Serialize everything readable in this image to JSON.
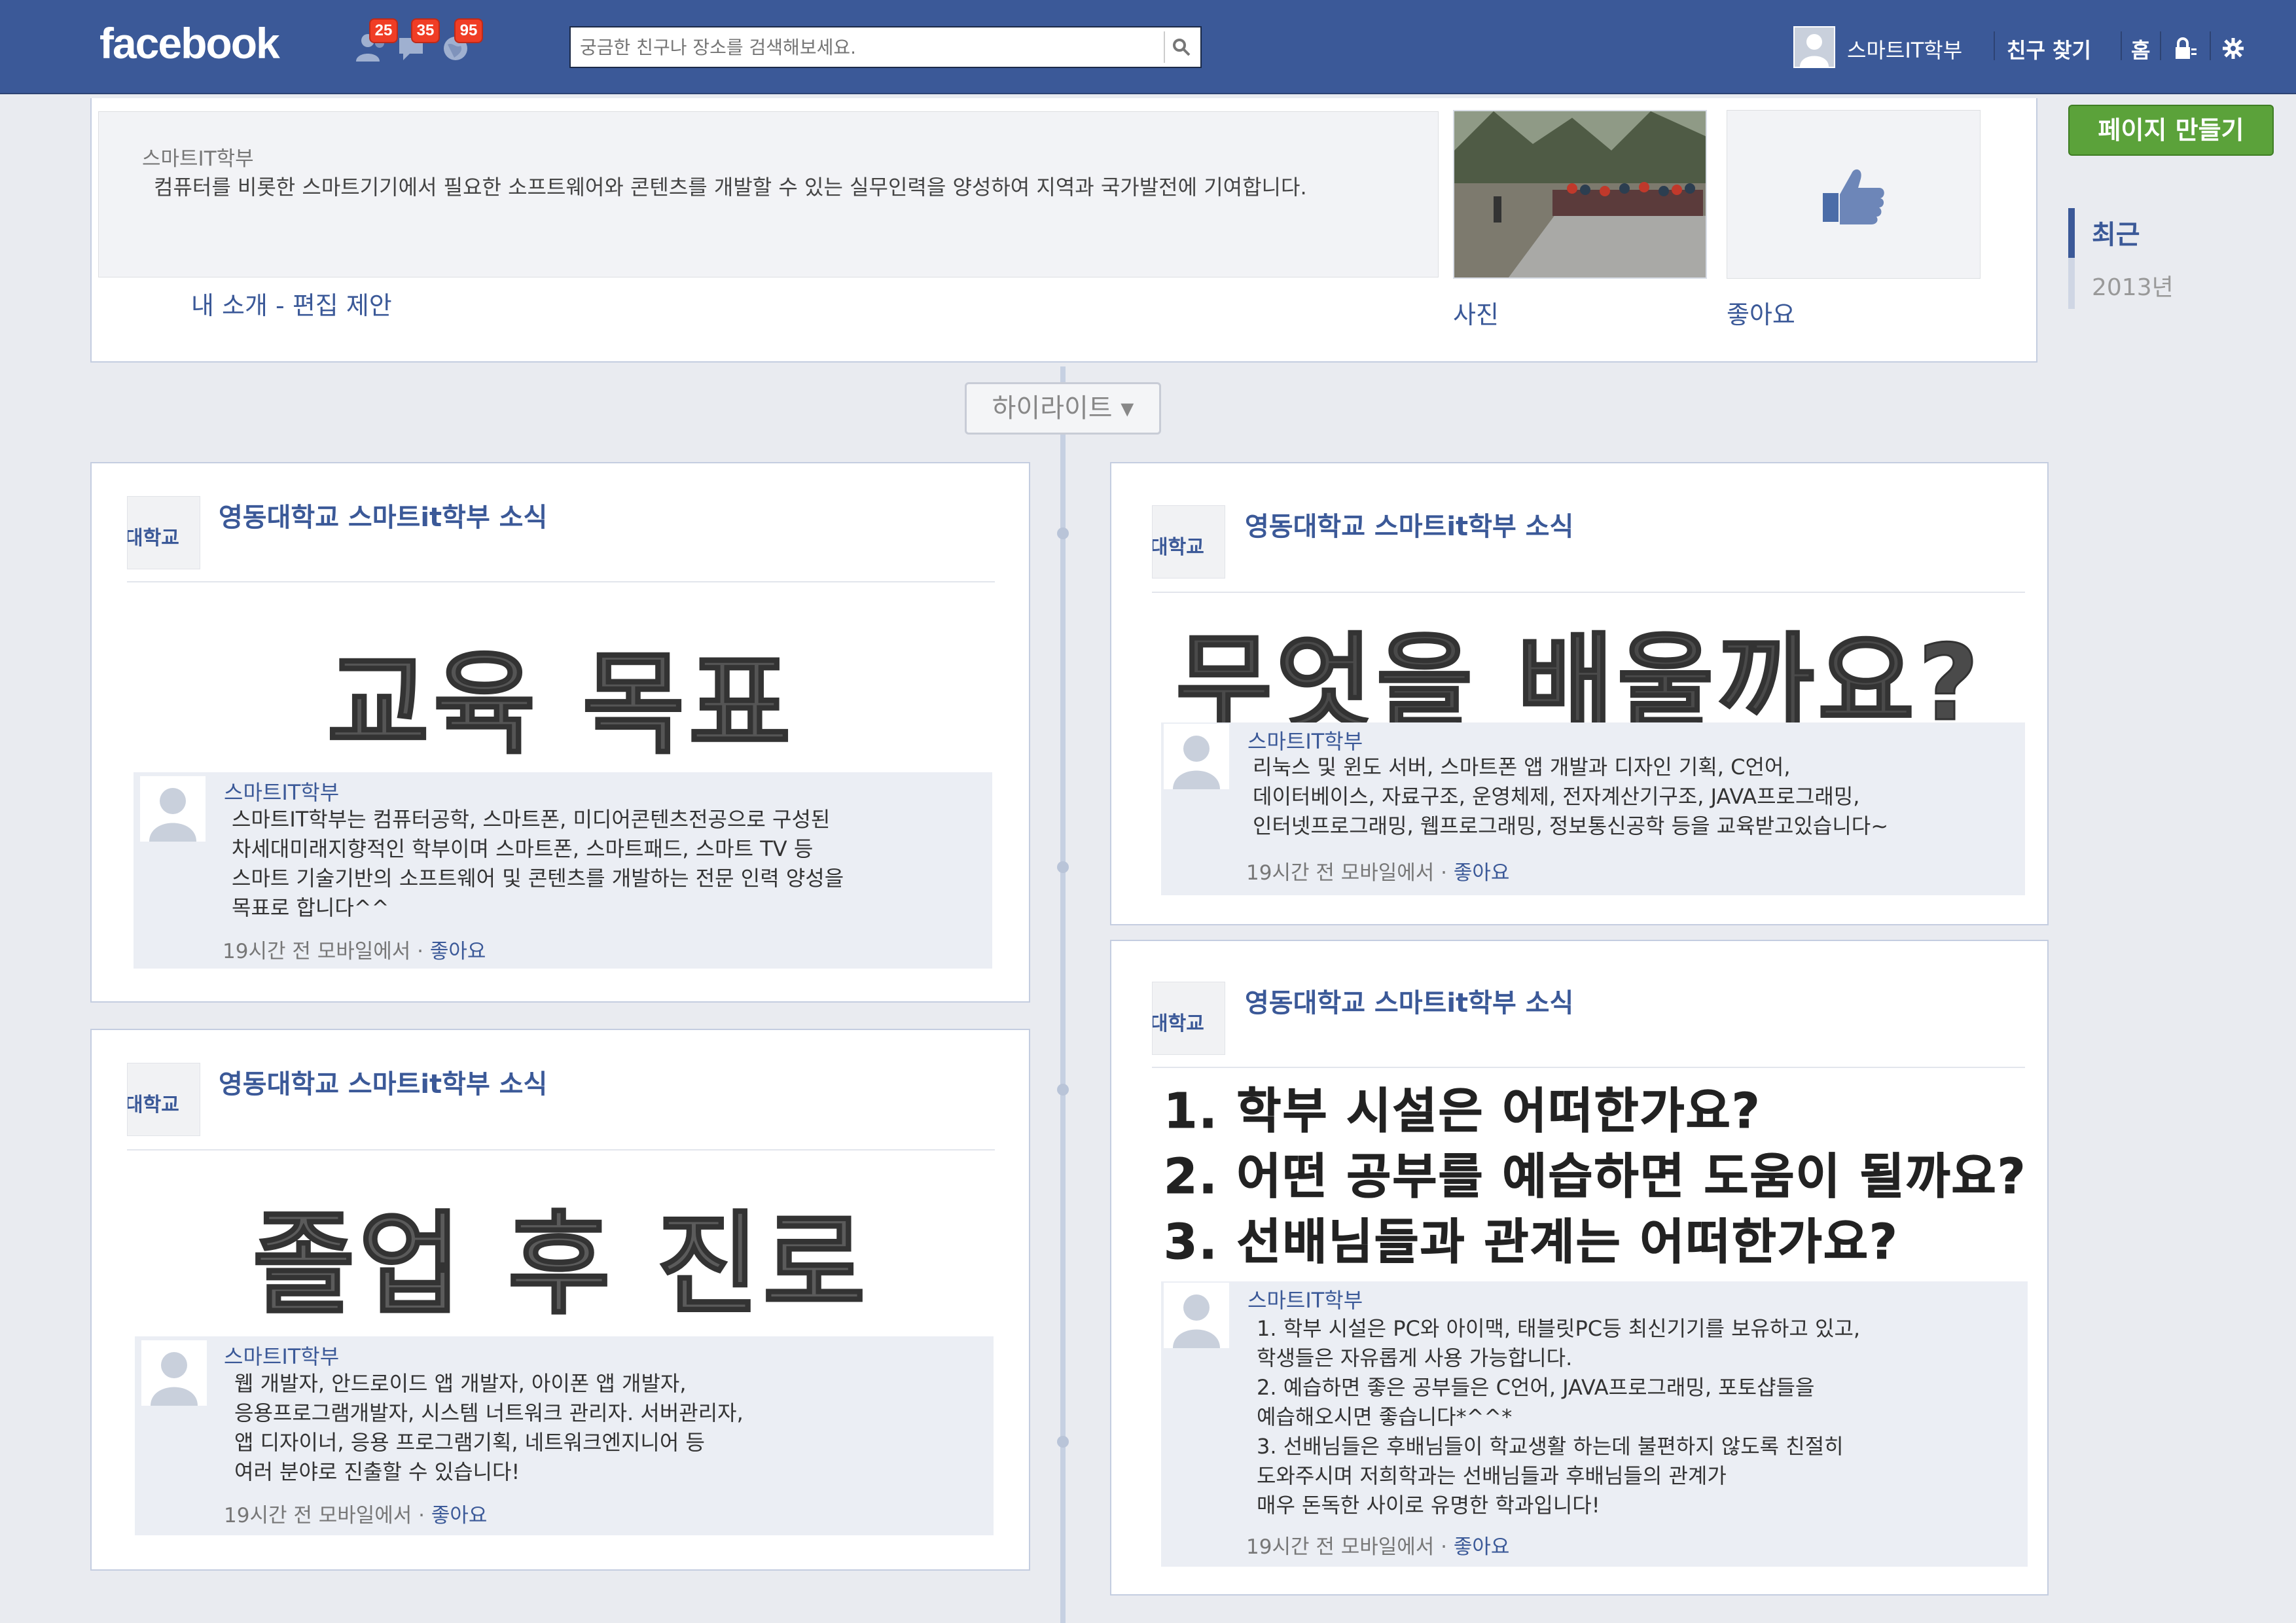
{
  "app": {
    "logo": "facebook",
    "brand_color": "#3b5998"
  },
  "notifications": [
    {
      "icon": "friend-requests-icon",
      "count": "25"
    },
    {
      "icon": "messages-icon",
      "count": "35"
    },
    {
      "icon": "notifications-globe-icon",
      "count": "95"
    }
  ],
  "search": {
    "placeholder": "궁금한 친구나 장소를 검색해보세요."
  },
  "nav": {
    "profile_name": "스마트IT학부",
    "find_friends": "친구 찾기",
    "home": "홈"
  },
  "intro": {
    "name": "스마트IT학부",
    "about": "컴퓨터를 비롯한 스마트기기에서 필요한 소프트웨어와 콘텐츠를 개발할 수 있는 실무인력을 양성하여 지역과 국가발전에 기여합니다.",
    "edit_link": "내 소개 - 편집 제안",
    "photos_label": "사진",
    "likes_label": "좋아요"
  },
  "sidebar": {
    "create_page": "페이지 만들기",
    "years": [
      "최근",
      "2013년"
    ]
  },
  "timeline": {
    "highlight_label": "하이라이트 ▾"
  },
  "posts": [
    {
      "author": "영동대학교 스마트it학부 소식",
      "logo_text": "대학교",
      "headline": [
        "교육 목표"
      ],
      "comment": {
        "name": "스마트IT학부",
        "text": "스마트IT학부는 컴퓨터공학, 스마트폰, 미디어콘텐츠전공으로 구성된\n차세대미래지향적인 학부이며 스마트폰, 스마트패드, 스마트 TV 등\n스마트 기술기반의 소프트웨어 및 콘텐츠를 개발하는 전문 인력 양성을\n목표로 합니다^^",
        "time": "19시간 전 모바일에서 · ",
        "like": "좋아요"
      }
    },
    {
      "author": "영동대학교 스마트it학부 소식",
      "logo_text": "대학교",
      "headline": [
        "무엇을 배울까요?"
      ],
      "comment": {
        "name": "스마트IT학부",
        "text": "리눅스 및 윈도 서버, 스마트폰 앱 개발과 디자인 기획, C언어,\n데이터베이스, 자료구조, 운영체제, 전자계산기구조, JAVA프로그래밍,\n인터넷프로그래밍, 웹프로그래밍, 정보통신공학 등을 교육받고있습니다~",
        "time": "19시간 전 모바일에서 · ",
        "like": "좋아요"
      }
    },
    {
      "author": "영동대학교 스마트it학부 소식",
      "logo_text": "대학교",
      "headline": [
        "졸업 후 진로"
      ],
      "comment": {
        "name": "스마트IT학부",
        "text": "웹 개발자, 안드로이드 앱 개발자, 아이폰 앱 개발자,\n응용프로그램개발자, 시스템 너트워크 관리자. 서버관리자,\n앱 디자이너, 응용 프로그램기획, 네트워크엔지니어 등\n여러 분야로 진출할 수 있습니다!",
        "time": "19시간 전 모바일에서 · ",
        "like": "좋아요"
      }
    },
    {
      "author": "영동대학교 스마트it학부 소식",
      "logo_text": "대학교",
      "headline": [
        "1. 학부 시설은 어떠한가요?",
        "2. 어떤 공부를 예습하면 도움이 될까요?",
        "3. 선배님들과 관계는 어떠한가요?"
      ],
      "comment": {
        "name": "스마트IT학부",
        "text": "1. 학부 시설은 PC와 아이맥, 태블릿PC등 최신기기를 보유하고 있고,\n학생들은 자유롭게 사용 가능합니다.\n2. 예습하면 좋은 공부들은 C언어, JAVA프로그래밍, 포토샵들을\n예습해오시면 좋습니다*^^*\n3. 선배님들은 후배님들이 학교생활 하는데 불편하지 않도록 친절히\n도와주시며 저희학과는 선배님들과 후배님들의 관계가\n매우 돈독한 사이로 유명한 학과입니다!",
        "time": "19시간 전 모바일에서 · ",
        "like": "좋아요"
      }
    }
  ]
}
